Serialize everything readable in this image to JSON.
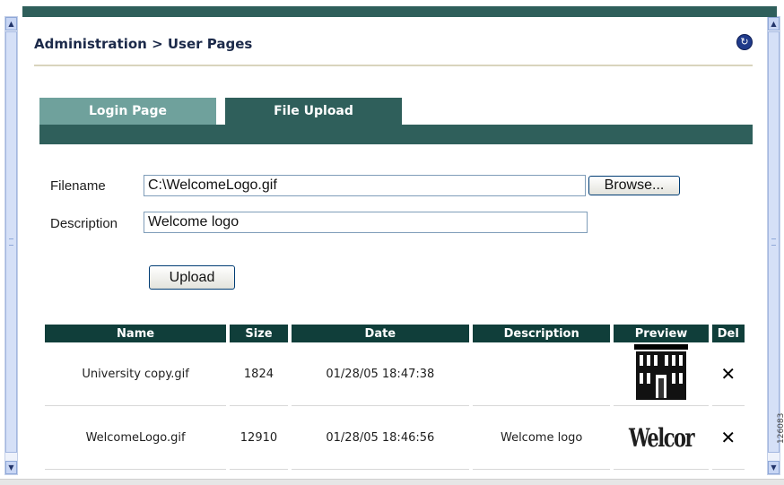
{
  "breadcrumb": "Administration > User Pages",
  "tabs": [
    {
      "label": "Login Page",
      "active": false
    },
    {
      "label": "File Upload",
      "active": true
    }
  ],
  "form": {
    "filename_label": "Filename",
    "filename_value": "C:\\WelcomeLogo.gif",
    "browse_label": "Browse...",
    "description_label": "Description",
    "description_value": "Welcome logo",
    "upload_label": "Upload"
  },
  "table": {
    "headers": [
      "Name",
      "Size",
      "Date",
      "Description",
      "Preview",
      "Del"
    ],
    "rows": [
      {
        "name": "University copy.gif",
        "size": "1824",
        "date": "01/28/05 18:47:38",
        "description": "",
        "preview": "building-image",
        "del": "✕"
      },
      {
        "name": "WelcomeLogo.gif",
        "size": "12910",
        "date": "01/28/05 18:46:56",
        "description": "Welcome logo",
        "preview": "Welcor",
        "del": "✕"
      }
    ]
  },
  "icons": {
    "refresh": "refresh-icon",
    "scroll_up": "scroll-up-icon",
    "scroll_down": "scroll-down-icon"
  },
  "colors": {
    "header_bar": "#2f5f5b",
    "tab_inactive": "#6fa19c",
    "table_header": "#103e3a"
  },
  "figure_number": "126083"
}
